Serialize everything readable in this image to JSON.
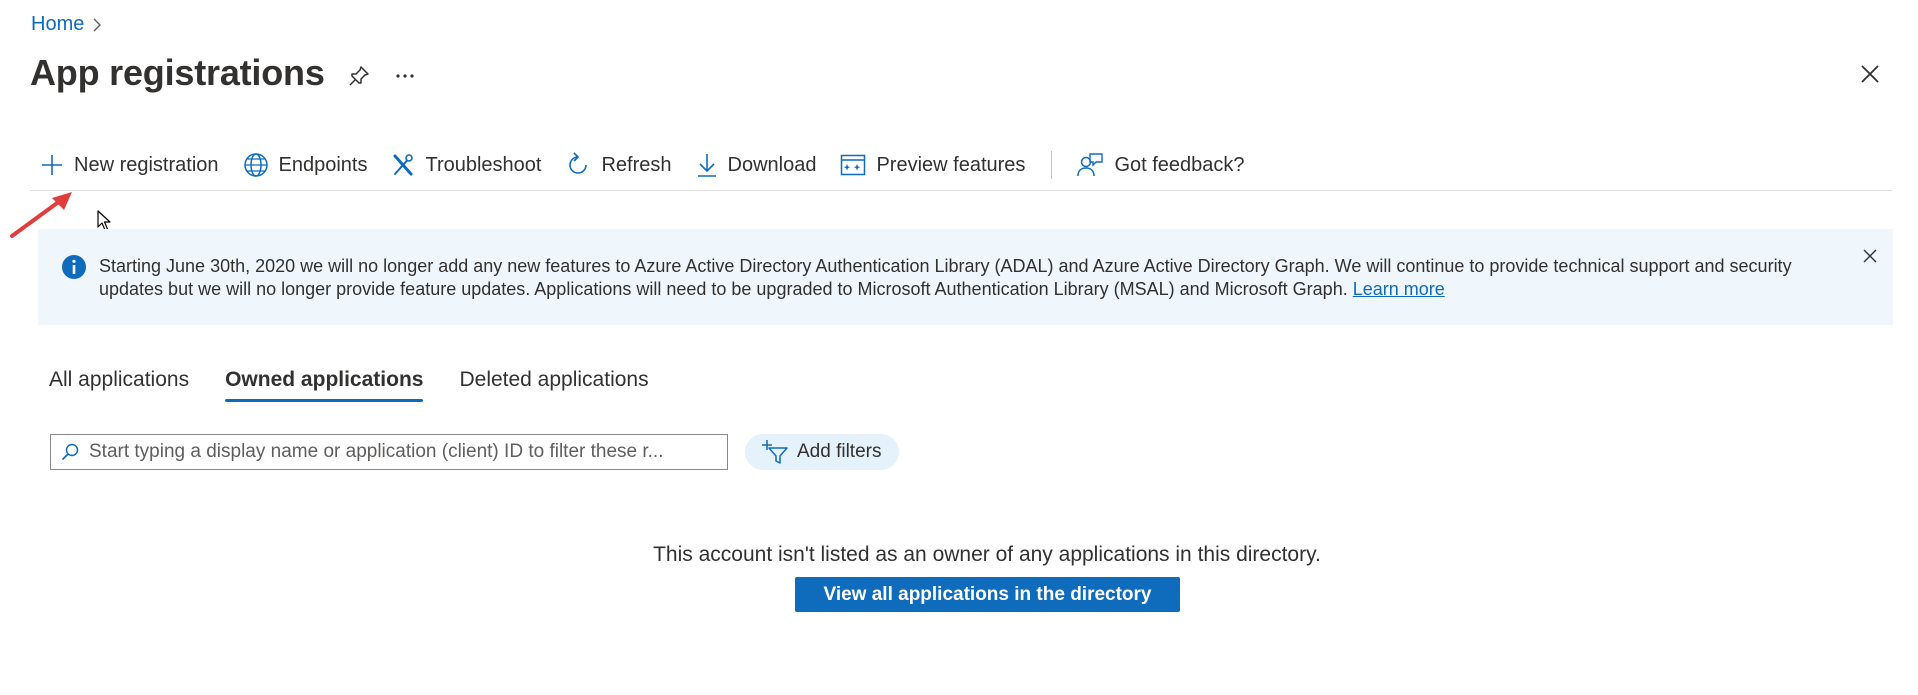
{
  "breadcrumb": {
    "home": "Home",
    "separator": "›"
  },
  "header": {
    "title": "App registrations",
    "pin_icon": "pin-icon",
    "more_icon": "ellipsis-icon",
    "close_icon": "close-icon"
  },
  "toolbar": {
    "new_registration": "New registration",
    "endpoints": "Endpoints",
    "troubleshoot": "Troubleshoot",
    "refresh": "Refresh",
    "download": "Download",
    "preview_features": "Preview features",
    "feedback": "Got feedback?"
  },
  "banner": {
    "text": "Starting June 30th, 2020 we will no longer add any new features to Azure Active Directory Authentication Library (ADAL) and Azure Active Directory Graph. We will continue to provide technical support and security updates but we will no longer provide feature updates. Applications will need to be upgraded to Microsoft Authentication Library (MSAL) and Microsoft Graph. ",
    "link": "Learn more",
    "icon": "info-icon"
  },
  "tabs": [
    {
      "label": "All applications",
      "active": false
    },
    {
      "label": "Owned applications",
      "active": true
    },
    {
      "label": "Deleted applications",
      "active": false
    }
  ],
  "filters": {
    "search_placeholder": "Start typing a display name or application (client) ID to filter these r...",
    "search_value": "",
    "add_filters": "Add filters"
  },
  "empty_state": {
    "message": "This account isn't listed as an owner of any applications in this directory.",
    "button": "View all applications in the directory"
  },
  "colors": {
    "accent": "#0f6cbd",
    "banner_bg": "#eff6fc",
    "filter_pill_bg": "#e5f1fb",
    "annotation_arrow": "#e23d3d"
  }
}
